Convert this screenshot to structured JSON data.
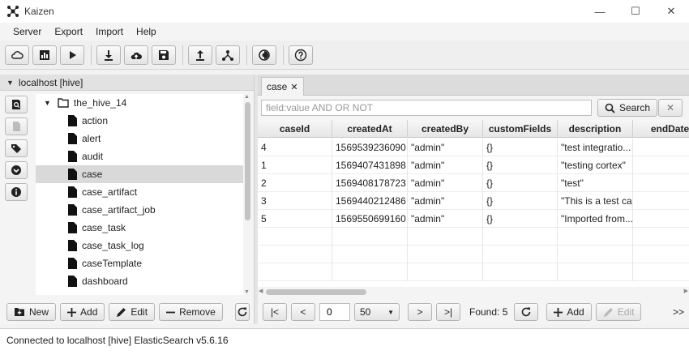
{
  "window": {
    "title": "Kaizen",
    "minimize": "—",
    "maximize": "☐",
    "close": "✕"
  },
  "menu": [
    "Server",
    "Export",
    "Import",
    "Help"
  ],
  "toolbar": {
    "icons": [
      "cloud-icon",
      "chart-icon",
      "play-icon",
      "download-icon",
      "cloud-upload-icon",
      "save-icon",
      "upload-icon",
      "network-icon",
      "theme-icon",
      "help-icon"
    ]
  },
  "connection": {
    "label": "localhost [hive]"
  },
  "tree": {
    "root": "the_hive_14",
    "items": [
      "action",
      "alert",
      "audit",
      "case",
      "case_artifact",
      "case_artifact_job",
      "case_task",
      "case_task_log",
      "caseTemplate",
      "dashboard"
    ],
    "selected": "case"
  },
  "left_buttons": {
    "new": "New",
    "add": "Add",
    "edit": "Edit",
    "remove": "Remove"
  },
  "tab": {
    "label": "case",
    "close": "✕"
  },
  "search": {
    "placeholder": "field:value AND OR NOT",
    "button": "Search",
    "clear": "✕"
  },
  "table": {
    "columns": [
      "caseId",
      "createdAt",
      "createdBy",
      "customFields",
      "description",
      "endDate"
    ],
    "rows": [
      [
        "4",
        "1569539236090",
        "\"admin\"",
        "{}",
        "\"test integratio..."
      ],
      [
        "1",
        "1569407431898",
        "\"admin\"",
        "{}",
        "\"testing cortex\""
      ],
      [
        "2",
        "1569408178723",
        "\"admin\"",
        "{}",
        "\"test\""
      ],
      [
        "3",
        "1569440212486",
        "\"admin\"",
        "{}",
        "\"This is a test ca..."
      ],
      [
        "5",
        "1569550699160",
        "\"admin\"",
        "{}",
        "\"Imported from..."
      ]
    ]
  },
  "pager": {
    "first": "|<",
    "prev": "<",
    "page": "0",
    "page_size": "50",
    "next": ">",
    "last": ">|",
    "found": "Found: 5",
    "add": "Add",
    "edit": "Edit",
    "more": ">>"
  },
  "status": "Connected to localhost [hive] ElasticSearch v5.6.16"
}
